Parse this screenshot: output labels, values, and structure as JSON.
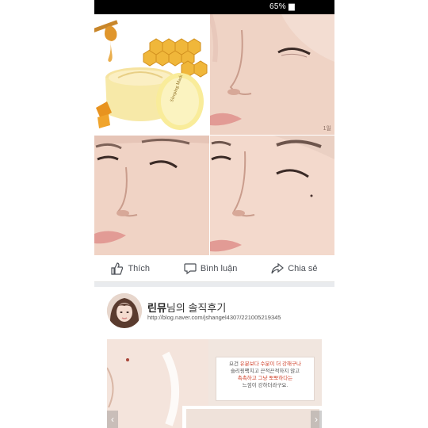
{
  "statusbar": {
    "battery_text": "65% ▆"
  },
  "photos": {
    "day_label": "1일"
  },
  "actions": {
    "like": "Thích",
    "comment": "Bình luận",
    "share": "Chia sẻ"
  },
  "post": {
    "name": "린뮤",
    "title_suffix": "님의 솔직후기",
    "url": "http://blog.naver.com/jshangel4307/221005219345",
    "quote": {
      "line1_pre": "요건 ",
      "line1_hl": "유분보다 수분이 더 강해구나",
      "line2": "슬리핑팩치고 끈적끈적하지 않고",
      "line3_hl": "촉촉하고 그냥 뽀뽀하다는",
      "line4": "느낌이 강하더라구요."
    },
    "nav_prev": "‹",
    "nav_next": "›"
  },
  "product": {
    "jar_label": "Sleeping Mask"
  },
  "colors": {
    "skin": "#f0d2c3",
    "honey": "#e8a53a",
    "statusbar": "#000000",
    "link_text": "#4b4f56",
    "highlight": "#d0432c"
  },
  "icons": {
    "like": "thumbs-up-icon",
    "comment": "speech-bubble-icon",
    "share": "share-arrow-icon"
  }
}
